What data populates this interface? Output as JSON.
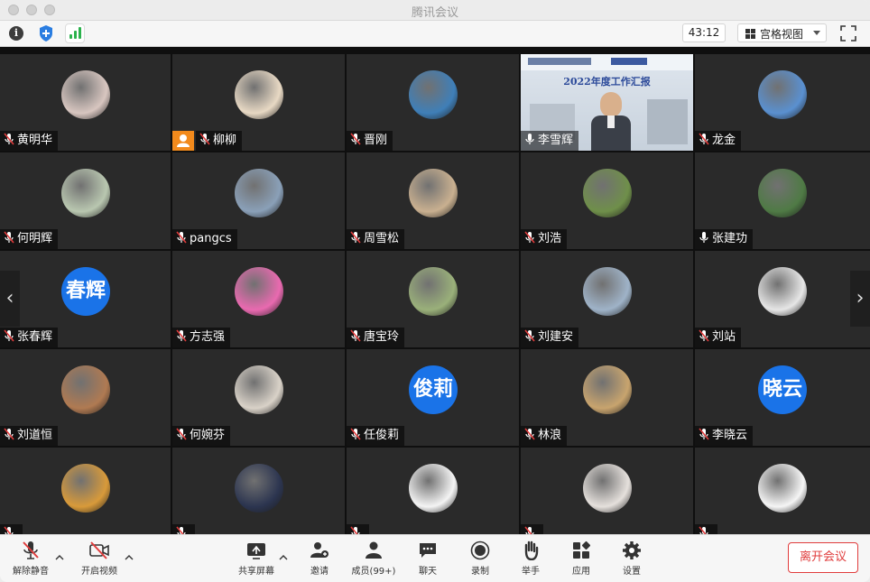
{
  "window": {
    "title": "腾讯会议"
  },
  "topbar": {
    "timer": "43:12",
    "view_label": "宫格视图"
  },
  "colors": {
    "accent": "#1a73e8",
    "leave": "#e03c3c",
    "host_badge": "#f28a1c",
    "signal": "#2bb24c"
  },
  "participants": [
    {
      "name": "黄明华",
      "muted": true,
      "avatar": "photo",
      "color": "#d8c6c0"
    },
    {
      "name": "柳柳",
      "muted": true,
      "avatar": "photo",
      "color": "#e8d9c4",
      "host": true
    },
    {
      "name": "晋刚",
      "muted": true,
      "avatar": "photo",
      "color": "#3f7fb8"
    },
    {
      "name": "李雪辉",
      "muted": false,
      "avatar": "video",
      "color": "#cfd8e2",
      "slide_title": "2022年度工作汇报"
    },
    {
      "name": "龙金",
      "muted": true,
      "avatar": "photo",
      "color": "#5a90d0"
    },
    {
      "name": "何明辉",
      "muted": true,
      "avatar": "photo",
      "color": "#b9c7b0"
    },
    {
      "name": "pangcs",
      "muted": true,
      "avatar": "photo",
      "color": "#8aa0b8"
    },
    {
      "name": "周雪松",
      "muted": true,
      "avatar": "photo",
      "color": "#c9b090"
    },
    {
      "name": "刘浩",
      "muted": true,
      "avatar": "photo",
      "color": "#6f8f4a"
    },
    {
      "name": "张建功",
      "muted": false,
      "avatar": "photo",
      "color": "#4f7a45"
    },
    {
      "name": "张春辉",
      "muted": true,
      "avatar": "text",
      "text": "春辉"
    },
    {
      "name": "方志强",
      "muted": true,
      "avatar": "photo",
      "color": "#e96ab0"
    },
    {
      "name": "唐宝玲",
      "muted": true,
      "avatar": "photo",
      "color": "#9ab07a"
    },
    {
      "name": "刘建安",
      "muted": true,
      "avatar": "photo",
      "color": "#9fb3c8"
    },
    {
      "name": "刘站",
      "muted": true,
      "avatar": "photo",
      "color": "#e6e6e6"
    },
    {
      "name": "刘道恒",
      "muted": true,
      "avatar": "photo",
      "color": "#b07a52"
    },
    {
      "name": "何婉芬",
      "muted": true,
      "avatar": "photo",
      "color": "#d9d2c8"
    },
    {
      "name": "任俊莉",
      "muted": true,
      "avatar": "text",
      "text": "俊莉"
    },
    {
      "name": "林浪",
      "muted": true,
      "avatar": "photo",
      "color": "#c8a46e"
    },
    {
      "name": "李晓云",
      "muted": true,
      "avatar": "text",
      "text": "晓云"
    },
    {
      "name": "",
      "muted": true,
      "avatar": "photo",
      "color": "#d89a3a"
    },
    {
      "name": "",
      "muted": true,
      "avatar": "photo",
      "color": "#2c3550"
    },
    {
      "name": "",
      "muted": true,
      "avatar": "photo",
      "color": "#f4f4f4"
    },
    {
      "name": "",
      "muted": true,
      "avatar": "photo",
      "color": "#e5e0dc"
    },
    {
      "name": "",
      "muted": true,
      "avatar": "photo",
      "color": "#f5f5f5"
    }
  ],
  "toolbar": {
    "unmute": "解除静音",
    "start_video": "开启视频",
    "share_screen": "共享屏幕",
    "invite": "邀请",
    "members": "成员(99+)",
    "chat": "聊天",
    "record": "录制",
    "raise_hand": "举手",
    "apps": "应用",
    "settings": "设置",
    "leave": "离开会议"
  }
}
